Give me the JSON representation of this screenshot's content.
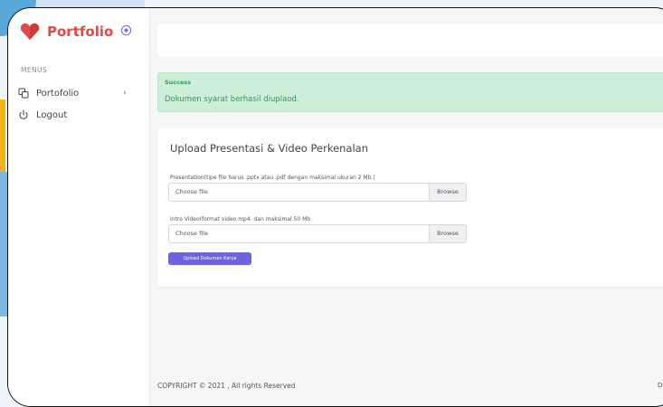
{
  "brand": {
    "name": "Portfolio",
    "color": "#e04a4a"
  },
  "sidebar": {
    "menus_label": "MENUS",
    "items": [
      {
        "label": "Portofolio",
        "icon": "copy-icon"
      },
      {
        "label": "Logout",
        "icon": "power-icon"
      }
    ]
  },
  "alert": {
    "title": "Success",
    "message": "Dokumen syarat berhasil diuplaod.",
    "color": "#2f9a5c"
  },
  "form": {
    "title": "Upload Presentasi & Video Perkenalan",
    "presentation_label": "Presentation(tipe file harus .pptx atau .pdf dengan maksimal ukuran 2 Mb.)",
    "presentation_value": "Choose file",
    "presentation_browse": "Browse",
    "video_label": "Intro Video(format video mp4. dan maksimal 50 Mb.",
    "video_value": "Choose file",
    "video_browse": "Browse",
    "submit_label": "Upload Dokumen Karya",
    "accent": "#6c63e0"
  },
  "footer": {
    "copyright": "COPYRIGHT © 2021 , All rights Reserved",
    "right_text": "De"
  }
}
